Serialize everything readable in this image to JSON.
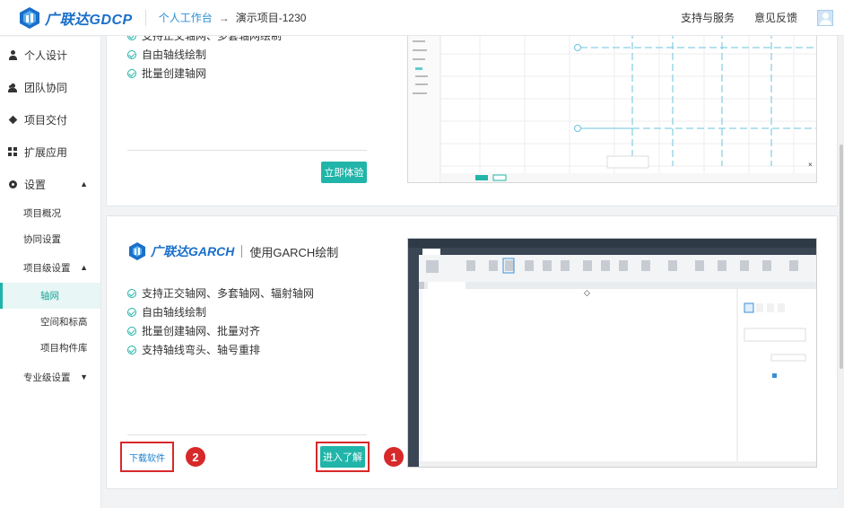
{
  "header": {
    "brand": "广联达GDCP",
    "breadcrumb": {
      "workspace": "个人工作台",
      "arrow": "→",
      "project": "演示项目-1230"
    },
    "support": "支持与服务",
    "feedback": "意见反馈"
  },
  "sidebar": {
    "items": [
      {
        "label": "个人设计",
        "icon": "person-icon"
      },
      {
        "label": "团队协同",
        "icon": "team-icon"
      },
      {
        "label": "项目交付",
        "icon": "layers-icon"
      },
      {
        "label": "扩展应用",
        "icon": "grid-icon"
      },
      {
        "label": "设置",
        "icon": "gear-icon"
      }
    ],
    "settings_sub": [
      "项目概况",
      "协同设置",
      "项目级设置"
    ],
    "project_level_sub": [
      "轴网",
      "空间和标高",
      "项目构件库"
    ],
    "professional": "专业级设置"
  },
  "card1": {
    "features": [
      "支持正交轴网、多套轴网绘制",
      "自由轴线绘制",
      "批量创建轴网"
    ],
    "try_button": "立即体验"
  },
  "card2": {
    "brand": "广联达GARCH",
    "subtitle": "使用GARCH绘制",
    "features": [
      "支持正交轴网、多套轴网、辐射轴网",
      "自由轴线绘制",
      "批量创建轴网、批量对齐",
      "支持轴线弯头、轴号重排"
    ],
    "download_button": "下载软件",
    "enter_button": "进入了解",
    "badges": [
      "1",
      "2"
    ]
  },
  "colors": {
    "accent": "#21b5a9",
    "brand": "#1a6fc9",
    "highlight": "#d7282a"
  }
}
